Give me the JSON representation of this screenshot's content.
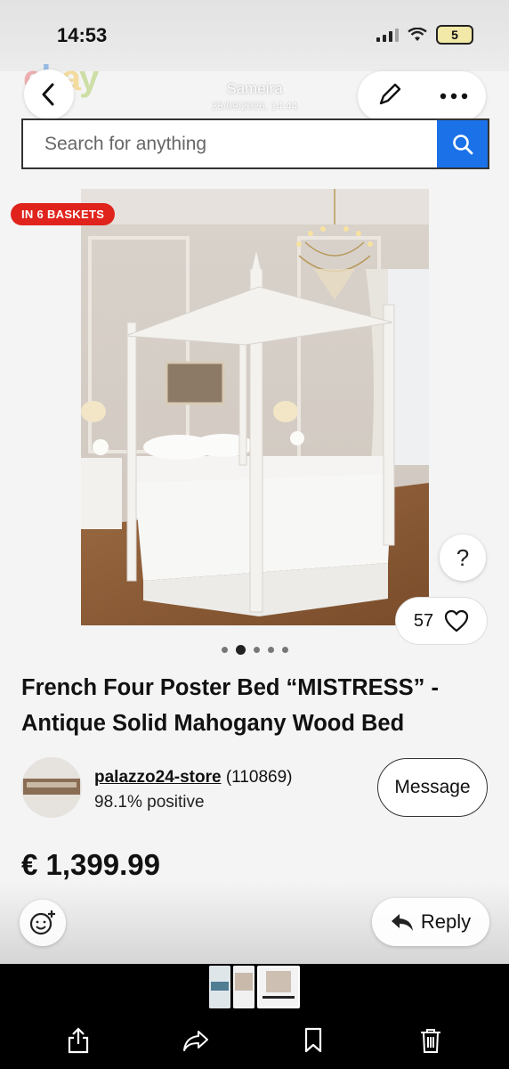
{
  "status": {
    "time": "14:53",
    "battery": "5"
  },
  "header": {
    "logo_letters": [
      "e",
      "b",
      "a",
      "y"
    ],
    "sender_name": "Sameira",
    "sent_date": "25/09/2026, 14:44"
  },
  "search": {
    "placeholder": "Search for anything"
  },
  "listing": {
    "badge": "IN 6 BASKETS",
    "help": "?",
    "watchers": "57",
    "image_count": 5,
    "active_image": 2,
    "title": "French Four Poster Bed “MISTRESS” - Antique Solid Mahogany Wood Bed",
    "seller": {
      "name": "palazzo24-store",
      "feedback": "(110869)",
      "positive": "98.1% positive"
    },
    "message_label": "Message",
    "price": "€ 1,399.99"
  },
  "reply": {
    "label": "Reply"
  },
  "icons": {
    "back": "chevron-left-icon",
    "edit": "pencil-icon",
    "more": "more-horizontal-icon",
    "search": "search-icon",
    "heart": "heart-icon",
    "share": "share-icon",
    "forward": "forward-icon",
    "bookmark": "bookmark-icon",
    "trash": "trash-icon"
  },
  "colors": {
    "accent_blue": "#1b72e8",
    "badge_red": "#e0241d"
  }
}
